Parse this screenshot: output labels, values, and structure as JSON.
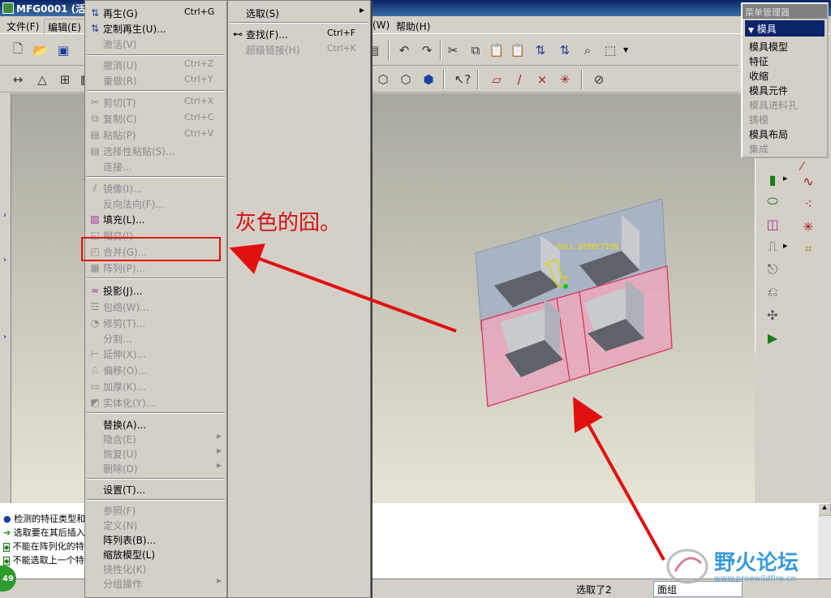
{
  "window": {
    "title": "MFG0001 (活动"
  },
  "menubar": {
    "file": "文件(F)",
    "edit": "编辑(E)",
    "w_suffix": "(W)",
    "help": "帮助(H)"
  },
  "edit_menu": {
    "items": [
      {
        "label": "再生(G)",
        "shortcut": "Ctrl+G",
        "enabled": true
      },
      {
        "label": "定制再生(U)...",
        "shortcut": "",
        "enabled": true
      },
      {
        "label": "激活(V)",
        "shortcut": "",
        "enabled": false
      },
      {
        "label": "撤消(U)",
        "shortcut": "Ctrl+Z",
        "enabled": false
      },
      {
        "label": "重做(R)",
        "shortcut": "Ctrl+Y",
        "enabled": false
      },
      {
        "label": "剪切(T)",
        "shortcut": "Ctrl+X",
        "enabled": false
      },
      {
        "label": "复制(C)",
        "shortcut": "Ctrl+C",
        "enabled": false
      },
      {
        "label": "粘贴(P)",
        "shortcut": "Ctrl+V",
        "enabled": false
      },
      {
        "label": "选择性粘贴(S)...",
        "shortcut": "",
        "enabled": false
      },
      {
        "label": "连接...",
        "shortcut": "",
        "enabled": false
      },
      {
        "label": "镜像(I)...",
        "shortcut": "",
        "enabled": false
      },
      {
        "label": "反向法向(F)...",
        "shortcut": "",
        "enabled": false
      },
      {
        "label": "填充(L)...",
        "shortcut": "",
        "enabled": true
      },
      {
        "label": "相交(I)",
        "shortcut": "",
        "enabled": false
      },
      {
        "label": "合并(G)...",
        "shortcut": "",
        "enabled": false
      },
      {
        "label": "阵列(P)...",
        "shortcut": "",
        "enabled": false
      },
      {
        "label": "投影(J)...",
        "shortcut": "",
        "enabled": true
      },
      {
        "label": "包络(W)...",
        "shortcut": "",
        "enabled": false
      },
      {
        "label": "修剪(T)...",
        "shortcut": "",
        "enabled": false
      },
      {
        "label": "分割...",
        "shortcut": "",
        "enabled": false
      },
      {
        "label": "延伸(X)...",
        "shortcut": "",
        "enabled": false
      },
      {
        "label": "偏移(O)...",
        "shortcut": "",
        "enabled": false
      },
      {
        "label": "加厚(K)...",
        "shortcut": "",
        "enabled": false
      },
      {
        "label": "实体化(Y)...",
        "shortcut": "",
        "enabled": false
      },
      {
        "label": "替换(A)...",
        "shortcut": "",
        "enabled": true
      },
      {
        "label": "隐含(E)",
        "shortcut": "",
        "enabled": false
      },
      {
        "label": "恢复(U)",
        "shortcut": "",
        "enabled": false
      },
      {
        "label": "删除(D)",
        "shortcut": "",
        "enabled": false
      },
      {
        "label": "设置(T)...",
        "shortcut": "",
        "enabled": true
      },
      {
        "label": "参照(F)",
        "shortcut": "",
        "enabled": false
      },
      {
        "label": "定义(N)",
        "shortcut": "",
        "enabled": false
      },
      {
        "label": "阵列表(B)...",
        "shortcut": "",
        "enabled": true
      },
      {
        "label": "缩放模型(L)",
        "shortcut": "",
        "enabled": true
      },
      {
        "label": "挠性化(K)",
        "shortcut": "",
        "enabled": false
      },
      {
        "label": "分组操作",
        "shortcut": "",
        "enabled": false
      }
    ]
  },
  "select_menu": {
    "items": [
      {
        "label": "选取(S)",
        "shortcut": "",
        "enabled": true
      },
      {
        "label": "查找(F)...",
        "shortcut": "Ctrl+F",
        "enabled": true
      },
      {
        "label": "超级链接(H)",
        "shortcut": "Ctrl+K",
        "enabled": false
      }
    ]
  },
  "menu_manager": {
    "title": "菜单管理器",
    "header": "模具",
    "items": [
      {
        "label": "模具模型",
        "enabled": true
      },
      {
        "label": "特征",
        "enabled": true
      },
      {
        "label": "收缩",
        "enabled": true
      },
      {
        "label": "模具元件",
        "enabled": true
      },
      {
        "label": "模具进料孔",
        "enabled": false
      },
      {
        "label": "铸模",
        "enabled": false
      },
      {
        "label": "模具布局",
        "enabled": true
      },
      {
        "label": "集成",
        "enabled": false
      }
    ]
  },
  "model": {
    "pull_direction_label": "PULL DIRECTION"
  },
  "annotation": {
    "text": "灰色的囧。"
  },
  "messages": [
    "检测的特征类型和",
    "选取要在其后插入",
    "不能在阵列化的特",
    "不能选取上一个特"
  ],
  "status": {
    "badge": "49",
    "selected": "选取了2",
    "filter": "面组"
  },
  "watermark": {
    "text": "野火论坛",
    "url": "www.proewildfire.cn"
  },
  "colors": {
    "annotation": "#e01010",
    "titlebar": "#0a246a",
    "pink_surface": "#e7a9bd",
    "blue_surface": "#a9b4c2"
  }
}
